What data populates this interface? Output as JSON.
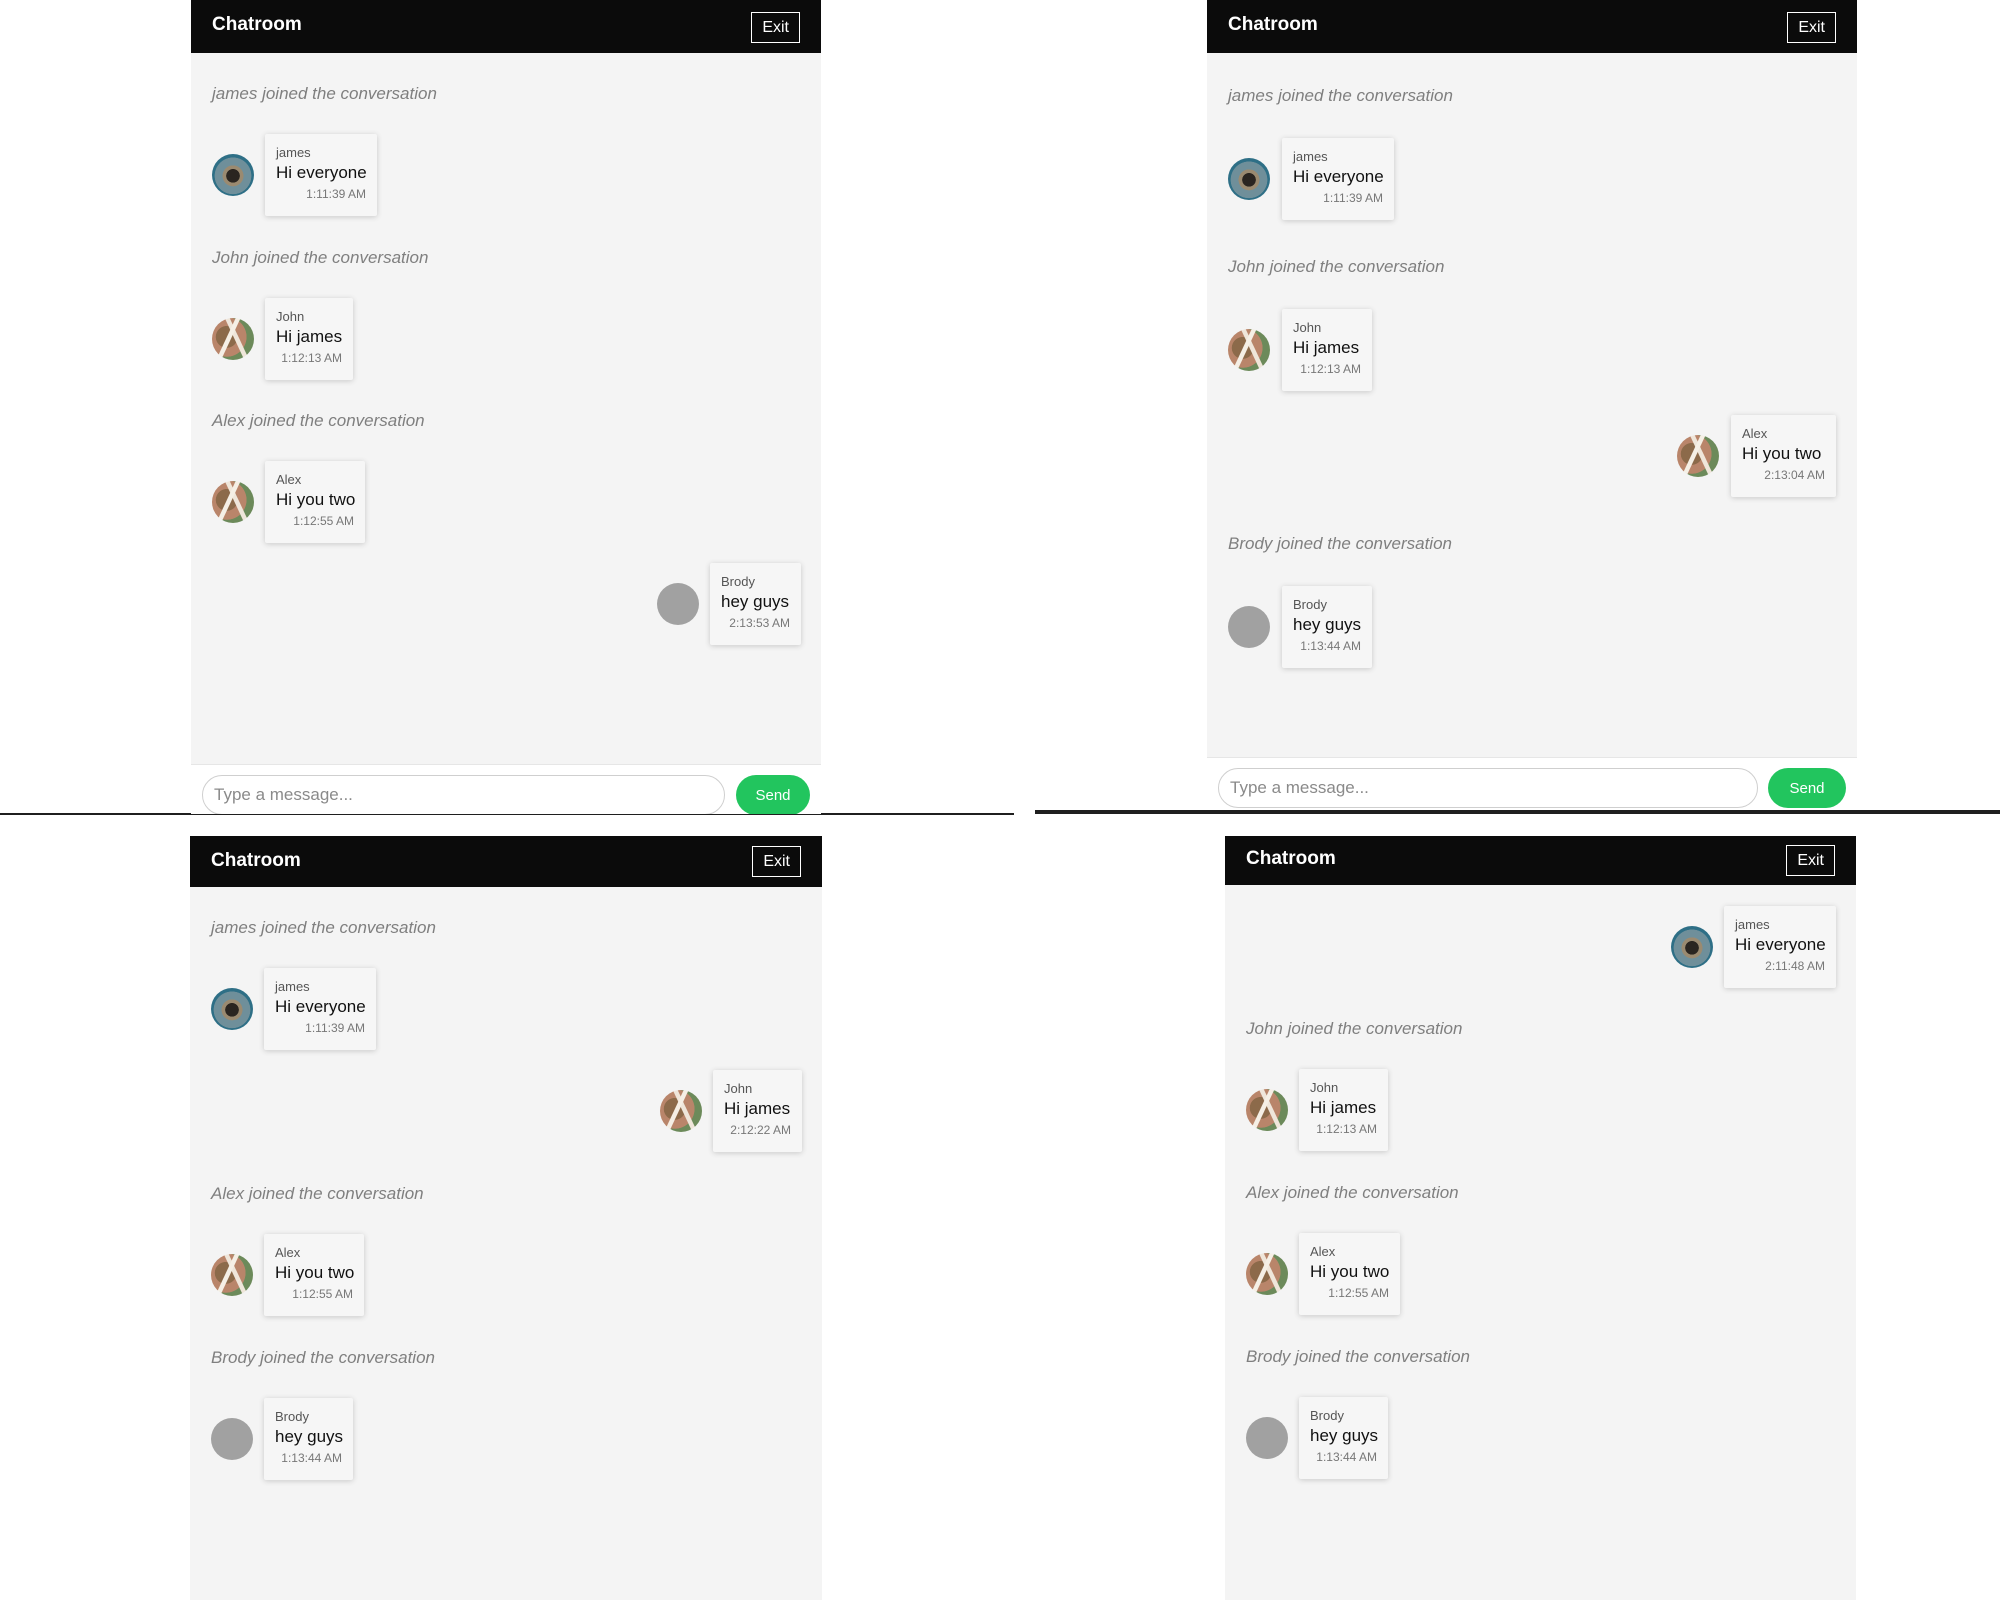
{
  "panels": [
    {
      "title": "Chatroom",
      "exit_label": "Exit",
      "input_placeholder": "Type a message...",
      "send_label": "Send",
      "items": [
        {
          "kind": "system",
          "text": "james joined the conversation"
        },
        {
          "kind": "message",
          "side": "left",
          "avatar": "james",
          "sender": "james",
          "text": "Hi everyone",
          "time": "1:11:39 AM"
        },
        {
          "kind": "system",
          "text": "John joined the conversation"
        },
        {
          "kind": "message",
          "side": "left",
          "avatar": "john",
          "sender": "John",
          "text": "Hi james",
          "time": "1:12:13 AM"
        },
        {
          "kind": "system",
          "text": "Alex joined the conversation"
        },
        {
          "kind": "message",
          "side": "left",
          "avatar": "alex",
          "sender": "Alex",
          "text": "Hi you two",
          "time": "1:12:55 AM"
        },
        {
          "kind": "message",
          "side": "right",
          "avatar": "generic",
          "sender": "Brody",
          "text": "hey guys",
          "time": "2:13:53 AM"
        }
      ]
    },
    {
      "title": "Chatroom",
      "exit_label": "Exit",
      "input_placeholder": "Type a message...",
      "send_label": "Send",
      "items": [
        {
          "kind": "system",
          "text": "james joined the conversation"
        },
        {
          "kind": "message",
          "side": "left",
          "avatar": "james",
          "sender": "james",
          "text": "Hi everyone",
          "time": "1:11:39 AM"
        },
        {
          "kind": "system",
          "text": "John joined the conversation"
        },
        {
          "kind": "message",
          "side": "left",
          "avatar": "john",
          "sender": "John",
          "text": "Hi james",
          "time": "1:12:13 AM"
        },
        {
          "kind": "message",
          "side": "right",
          "avatar": "alex",
          "sender": "Alex",
          "text": "Hi you two",
          "time": "2:13:04 AM"
        },
        {
          "kind": "system",
          "text": "Brody joined the conversation"
        },
        {
          "kind": "message",
          "side": "left",
          "avatar": "generic",
          "sender": "Brody",
          "text": "hey guys",
          "time": "1:13:44 AM"
        }
      ]
    },
    {
      "title": "Chatroom",
      "exit_label": "Exit",
      "items": [
        {
          "kind": "system",
          "text": "james joined the conversation"
        },
        {
          "kind": "message",
          "side": "left",
          "avatar": "james",
          "sender": "james",
          "text": "Hi everyone",
          "time": "1:11:39 AM"
        },
        {
          "kind": "message",
          "side": "right",
          "avatar": "john",
          "sender": "John",
          "text": "Hi james",
          "time": "2:12:22 AM"
        },
        {
          "kind": "system",
          "text": "Alex joined the conversation"
        },
        {
          "kind": "message",
          "side": "left",
          "avatar": "alex",
          "sender": "Alex",
          "text": "Hi you two",
          "time": "1:12:55 AM"
        },
        {
          "kind": "system",
          "text": "Brody joined the conversation"
        },
        {
          "kind": "message",
          "side": "left",
          "avatar": "generic",
          "sender": "Brody",
          "text": "hey guys",
          "time": "1:13:44 AM"
        }
      ]
    },
    {
      "title": "Chatroom",
      "exit_label": "Exit",
      "items": [
        {
          "kind": "message",
          "side": "right",
          "avatar": "james",
          "sender": "james",
          "text": "Hi everyone",
          "time": "2:11:48 AM"
        },
        {
          "kind": "system",
          "text": "John joined the conversation"
        },
        {
          "kind": "message",
          "side": "left",
          "avatar": "john",
          "sender": "John",
          "text": "Hi james",
          "time": "1:12:13 AM"
        },
        {
          "kind": "system",
          "text": "Alex joined the conversation"
        },
        {
          "kind": "message",
          "side": "left",
          "avatar": "alex",
          "sender": "Alex",
          "text": "Hi you two",
          "time": "1:12:55 AM"
        },
        {
          "kind": "system",
          "text": "Brody joined the conversation"
        },
        {
          "kind": "message",
          "side": "left",
          "avatar": "generic",
          "sender": "Brody",
          "text": "hey guys",
          "time": "1:13:44 AM"
        }
      ]
    }
  ],
  "colors": {
    "header_bg": "#0b0b0b",
    "panel_bg": "#f4f4f4",
    "send_button": "#22c55e",
    "generic_avatar": "#a1a1a1"
  }
}
